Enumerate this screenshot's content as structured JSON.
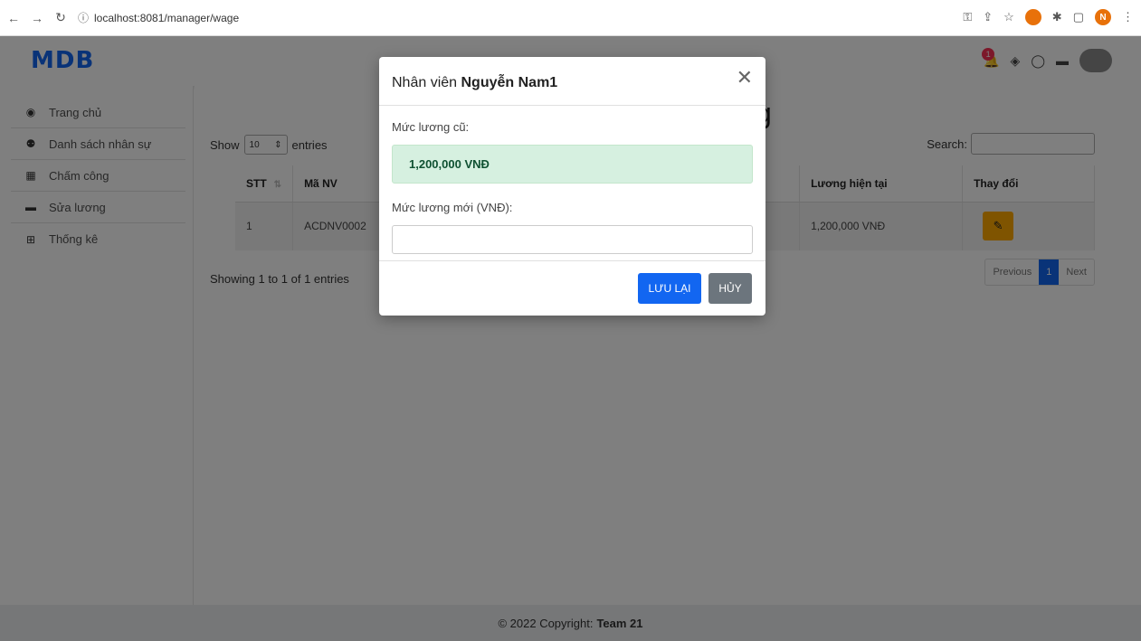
{
  "browser": {
    "url": "localhost:8081/manager/wage",
    "profile_initial": "N"
  },
  "header": {
    "logo": "MDB",
    "notification_count": "1"
  },
  "sidebar": {
    "items": [
      {
        "label": "Trang chủ",
        "icon": "gauge-icon"
      },
      {
        "label": "Danh sách nhân sự",
        "icon": "users-icon"
      },
      {
        "label": "Chấm công",
        "icon": "calendar-icon"
      },
      {
        "label": "Sửa lương",
        "icon": "money-bill-icon"
      },
      {
        "label": "Thống kê",
        "icon": "table-icon"
      }
    ]
  },
  "main": {
    "title_fragment": "g",
    "show_label": "Show",
    "entries_label": "entries",
    "page_size": "10",
    "search_label": "Search:",
    "columns": [
      "STT",
      "Mã NV",
      "Lương hiện tại",
      "Thay đổi"
    ],
    "rows": [
      {
        "stt": "1",
        "ma_nv": "ACDNV0002",
        "luong": "1,200,000 VNĐ"
      }
    ],
    "showing_text": "Showing 1 to 1 of 1 entries",
    "pager": {
      "previous": "Previous",
      "page": "1",
      "next": "Next"
    }
  },
  "modal": {
    "title_prefix": "Nhân viên",
    "employee_name": "Nguyễn Nam1",
    "old_label": "Mức lương cũ:",
    "old_value": "1,200,000 VNĐ",
    "new_label": "Mức lương mới (VNĐ):",
    "new_value": "",
    "save_label": "LƯU LẠI",
    "cancel_label": "HỦY"
  },
  "footer": {
    "copyright": "© 2022 Copyright:",
    "team": "Team 21"
  },
  "colors": {
    "primary": "#1266f1",
    "warning": "#ffa900",
    "success_bg": "#d6f0e0",
    "secondary": "#6c757d"
  }
}
